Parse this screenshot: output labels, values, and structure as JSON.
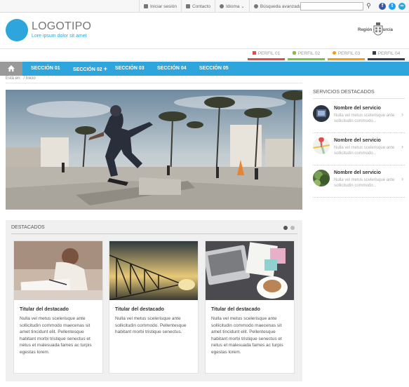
{
  "topbar": {
    "login": "Iniciar sesión",
    "contact": "Contacto",
    "language": "Idioma",
    "advanced_search": "Búsqueda avanzada",
    "search_placeholder": ""
  },
  "header": {
    "logo": "LOGOTIPO",
    "tagline": "Lore ipsum dolor sit amet",
    "region": "Región de Murcia"
  },
  "profiles": [
    {
      "label": "PERFIL 01",
      "color": "#e24b4b"
    },
    {
      "label": "PERFIL 02",
      "color": "#7bc043"
    },
    {
      "label": "PERFIL 03",
      "color": "#f39c12"
    },
    {
      "label": "PERFIL 04",
      "color": "#2c3e50"
    }
  ],
  "nav": {
    "items": [
      "SECCIÓN 01",
      "SECCIÓN 02",
      "SECCIÓN 03",
      "SECCIÓN 04",
      "SECCIÓN 05"
    ],
    "plus": "+"
  },
  "breadcrumb": {
    "prefix": "Está en:",
    "sep": "/",
    "current": "Inicio"
  },
  "sidebar": {
    "title": "SERVICIOS DESTACADOS",
    "services": [
      {
        "title": "Nombre del servicio",
        "desc": "Nulla vel metus scelerisque ante sollicitudin commodo..."
      },
      {
        "title": "Nombre del servicio",
        "desc": "Nulla vel metus scelerisque ante sollicitudin commodo..."
      },
      {
        "title": "Nombre del servicio",
        "desc": "Nulla vel metus scelerisque ante sollicitudin commodo..."
      }
    ]
  },
  "featured": {
    "title": "DESTACADOS",
    "cards": [
      {
        "title": "Titular del destacado",
        "text": "Nulla vel metus scelerisque ante sollicitudin commodo maecenas sit amet tincidunt elit. Pellentesque habitant morbi tristique senectus et netus et malesuada fames ac turpis egestas lorem."
      },
      {
        "title": "Titular del destacado",
        "text": "Nulla vel metus scelerisque ante sollicitudin commodo. Pellentesque habitant morbi tristique senectus."
      },
      {
        "title": "Titular del destacado",
        "text": "Nulla vel metus scelerisque ante sollicitudin commodo maecenas sit amet tincidunt elit. Pellentesque habitant morbi tristique senectus et netus et malesuada fames ac turpis egestas lorem."
      }
    ]
  }
}
